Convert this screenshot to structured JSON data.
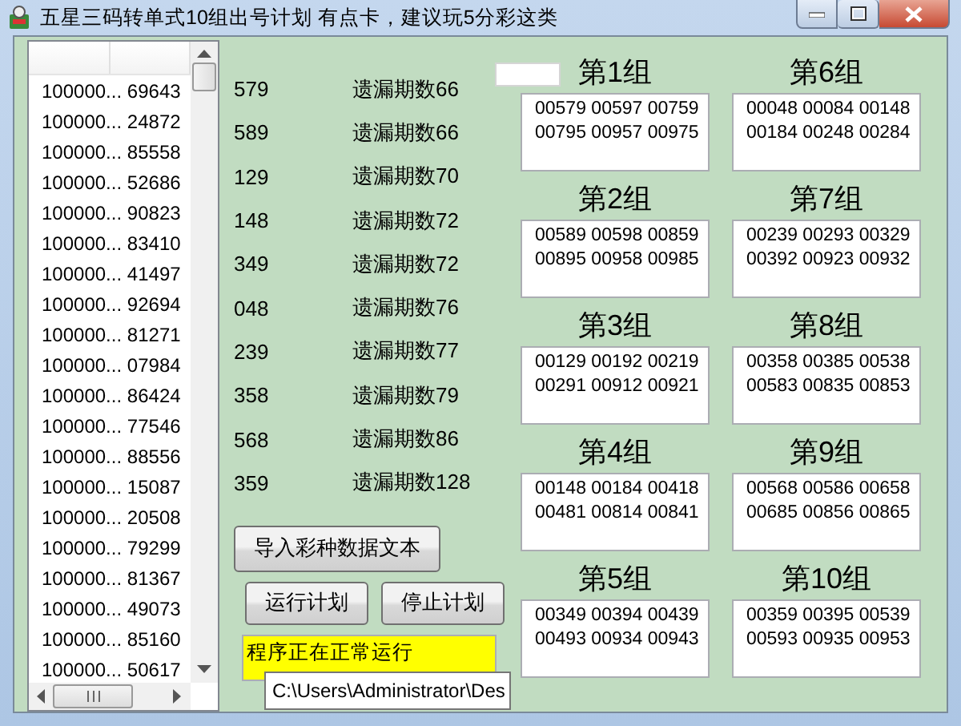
{
  "window": {
    "title": "五星三码转单式10组出号计划 有点卡，建议玩5分彩这类"
  },
  "list": {
    "rows": [
      {
        "column_1": "100000...",
        "column_2": "69643"
      },
      {
        "column_1": "100000...",
        "column_2": "24872"
      },
      {
        "column_1": "100000...",
        "column_2": "85558"
      },
      {
        "column_1": "100000...",
        "column_2": "52686"
      },
      {
        "column_1": "100000...",
        "column_2": "90823"
      },
      {
        "column_1": "100000...",
        "column_2": "83410"
      },
      {
        "column_1": "100000...",
        "column_2": "41497"
      },
      {
        "column_1": "100000...",
        "column_2": "92694"
      },
      {
        "column_1": "100000...",
        "column_2": "81271"
      },
      {
        "column_1": "100000...",
        "column_2": "07984"
      },
      {
        "column_1": "100000...",
        "column_2": "86424"
      },
      {
        "column_1": "100000...",
        "column_2": "77546"
      },
      {
        "column_1": "100000...",
        "column_2": "88556"
      },
      {
        "column_1": "100000...",
        "column_2": "15087"
      },
      {
        "column_1": "100000...",
        "column_2": "20508"
      },
      {
        "column_1": "100000...",
        "column_2": "79299"
      },
      {
        "column_1": "100000...",
        "column_2": "81367"
      },
      {
        "column_1": "100000...",
        "column_2": "49073"
      },
      {
        "column_1": "100000...",
        "column_2": "85160"
      },
      {
        "column_1": "100000...",
        "column_2": "50617"
      }
    ]
  },
  "omissions": [
    {
      "number": "579",
      "label": "遗漏期数66"
    },
    {
      "number": "589",
      "label": "遗漏期数66"
    },
    {
      "number": "129",
      "label": "遗漏期数70"
    },
    {
      "number": "148",
      "label": "遗漏期数72"
    },
    {
      "number": "349",
      "label": "遗漏期数72"
    },
    {
      "number": "048",
      "label": "遗漏期数76"
    },
    {
      "number": "239",
      "label": "遗漏期数77"
    },
    {
      "number": "358",
      "label": "遗漏期数79"
    },
    {
      "number": "568",
      "label": "遗漏期数86"
    },
    {
      "number": "359",
      "label": "遗漏期数128"
    }
  ],
  "buttons": {
    "import": "导入彩种数据文本",
    "run": "运行计划",
    "stop": "停止计划"
  },
  "status": "程序正在正常运行",
  "tooltip": "C:\\Users\\Administrator\\Des",
  "groups": [
    {
      "title": "第1组",
      "lines": [
        "00579 00597 00759",
        "00795 00957 00975"
      ]
    },
    {
      "title": "第2组",
      "lines": [
        "00589 00598 00859",
        "00895 00958 00985"
      ]
    },
    {
      "title": "第3组",
      "lines": [
        "00129 00192 00219",
        "00291 00912 00921"
      ]
    },
    {
      "title": "第4组",
      "lines": [
        "00148 00184 00418",
        "00481 00814 00841"
      ]
    },
    {
      "title": "第5组",
      "lines": [
        "00349 00394 00439",
        "00493 00934 00943"
      ]
    },
    {
      "title": "第6组",
      "lines": [
        "00048 00084 00148",
        "00184 00248 00284"
      ]
    },
    {
      "title": "第7组",
      "lines": [
        "00239 00293 00329",
        "00392 00923 00932"
      ]
    },
    {
      "title": "第8组",
      "lines": [
        "00358 00385 00538",
        "00583 00835 00853"
      ]
    },
    {
      "title": "第9组",
      "lines": [
        "00568 00586 00658",
        "00685 00856 00865"
      ]
    },
    {
      "title": "第10组",
      "lines": [
        "00359 00395 00539",
        "00593 00935 00953"
      ]
    }
  ]
}
